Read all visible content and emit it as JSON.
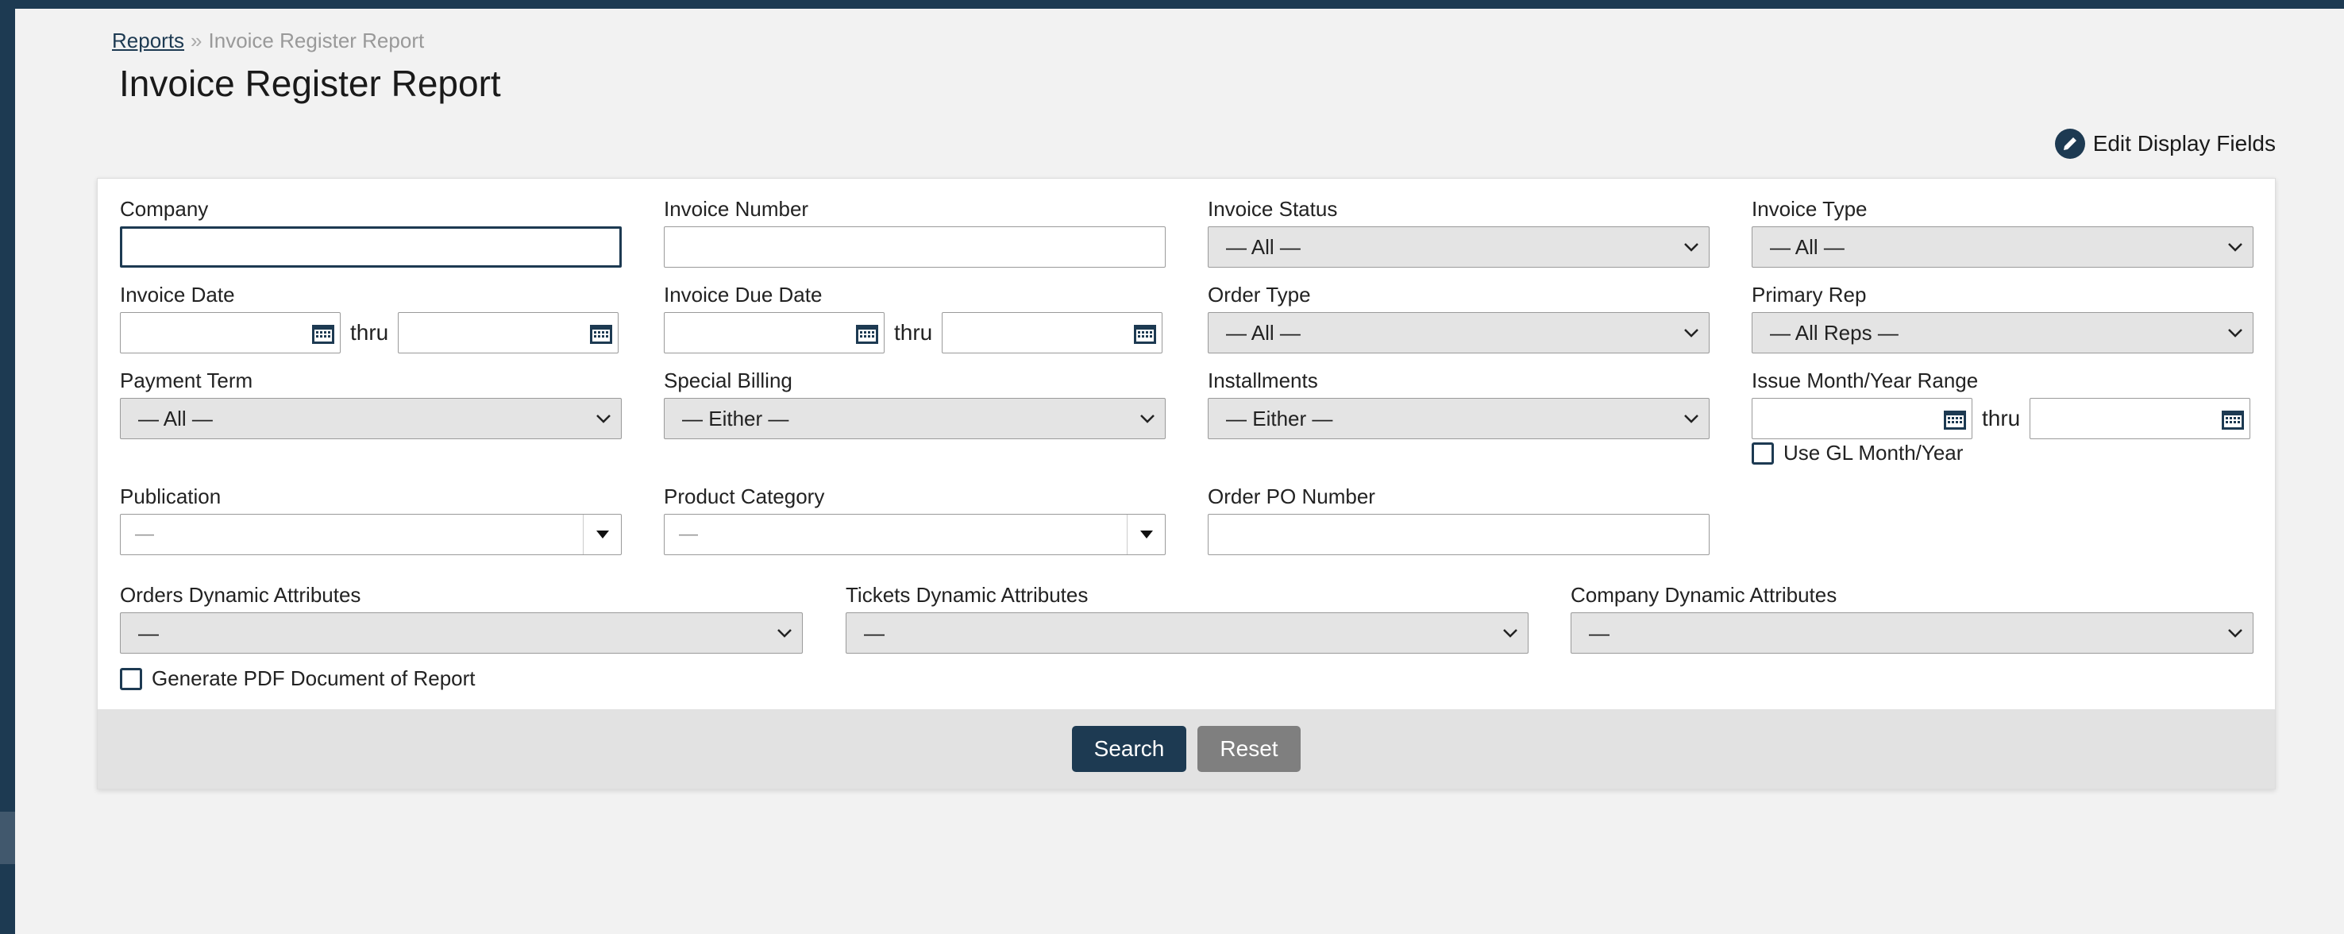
{
  "breadcrumb": {
    "root": "Reports",
    "separator": "»",
    "current": "Invoice Register Report"
  },
  "page_title": "Invoice Register Report",
  "edit_display_fields": {
    "label": "Edit Display Fields",
    "icon": "pencil-icon"
  },
  "fields": {
    "company": {
      "label": "Company",
      "value": ""
    },
    "invoice_number": {
      "label": "Invoice Number",
      "value": ""
    },
    "invoice_status": {
      "label": "Invoice Status",
      "value": "— All —"
    },
    "invoice_type": {
      "label": "Invoice Type",
      "value": "— All —"
    },
    "invoice_date": {
      "label": "Invoice Date",
      "thru": "thru"
    },
    "invoice_due_date": {
      "label": "Invoice Due Date",
      "thru": "thru"
    },
    "order_type": {
      "label": "Order Type",
      "value": "— All —"
    },
    "primary_rep": {
      "label": "Primary Rep",
      "value": "— All Reps —"
    },
    "payment_term": {
      "label": "Payment Term",
      "value": "— All —"
    },
    "special_billing": {
      "label": "Special Billing",
      "value": "— Either —"
    },
    "installments": {
      "label": "Installments",
      "value": "— Either —"
    },
    "issue_month_year_range": {
      "label": "Issue Month/Year Range",
      "thru": "thru"
    },
    "use_gl_month_year": {
      "label": "Use GL Month/Year",
      "checked": false
    },
    "publication": {
      "label": "Publication",
      "value": "—"
    },
    "product_category": {
      "label": "Product Category",
      "value": "—"
    },
    "order_po_number": {
      "label": "Order PO Number",
      "value": ""
    },
    "orders_dynamic_attributes": {
      "label": "Orders Dynamic Attributes",
      "value": "—"
    },
    "tickets_dynamic_attributes": {
      "label": "Tickets Dynamic Attributes",
      "value": "—"
    },
    "company_dynamic_attributes": {
      "label": "Company Dynamic Attributes",
      "value": "—"
    },
    "generate_pdf": {
      "label": "Generate PDF Document of Report",
      "checked": false
    }
  },
  "buttons": {
    "search": "Search",
    "reset": "Reset"
  },
  "colors": {
    "primary": "#1d3a52",
    "reset": "#7f7f7f",
    "select_bg": "#e4e4e4",
    "footer_bg": "#e2e2e2"
  }
}
